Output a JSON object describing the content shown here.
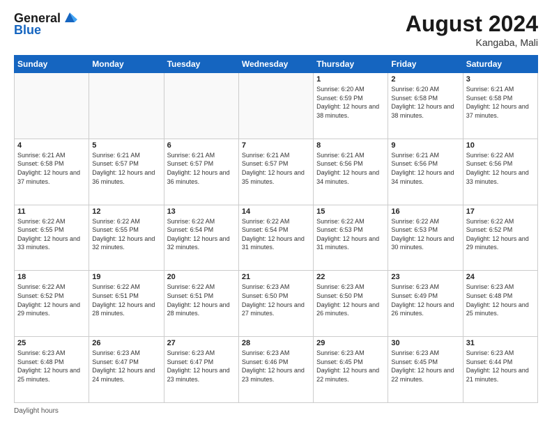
{
  "header": {
    "logo_general": "General",
    "logo_blue": "Blue",
    "month_year": "August 2024",
    "location": "Kangaba, Mali"
  },
  "footer": {
    "daylight_label": "Daylight hours"
  },
  "days_of_week": [
    "Sunday",
    "Monday",
    "Tuesday",
    "Wednesday",
    "Thursday",
    "Friday",
    "Saturday"
  ],
  "weeks": [
    [
      {
        "day": "",
        "info": ""
      },
      {
        "day": "",
        "info": ""
      },
      {
        "day": "",
        "info": ""
      },
      {
        "day": "",
        "info": ""
      },
      {
        "day": "1",
        "info": "Sunrise: 6:20 AM\nSunset: 6:59 PM\nDaylight: 12 hours\nand 38 minutes."
      },
      {
        "day": "2",
        "info": "Sunrise: 6:20 AM\nSunset: 6:58 PM\nDaylight: 12 hours\nand 38 minutes."
      },
      {
        "day": "3",
        "info": "Sunrise: 6:21 AM\nSunset: 6:58 PM\nDaylight: 12 hours\nand 37 minutes."
      }
    ],
    [
      {
        "day": "4",
        "info": "Sunrise: 6:21 AM\nSunset: 6:58 PM\nDaylight: 12 hours\nand 37 minutes."
      },
      {
        "day": "5",
        "info": "Sunrise: 6:21 AM\nSunset: 6:57 PM\nDaylight: 12 hours\nand 36 minutes."
      },
      {
        "day": "6",
        "info": "Sunrise: 6:21 AM\nSunset: 6:57 PM\nDaylight: 12 hours\nand 36 minutes."
      },
      {
        "day": "7",
        "info": "Sunrise: 6:21 AM\nSunset: 6:57 PM\nDaylight: 12 hours\nand 35 minutes."
      },
      {
        "day": "8",
        "info": "Sunrise: 6:21 AM\nSunset: 6:56 PM\nDaylight: 12 hours\nand 34 minutes."
      },
      {
        "day": "9",
        "info": "Sunrise: 6:21 AM\nSunset: 6:56 PM\nDaylight: 12 hours\nand 34 minutes."
      },
      {
        "day": "10",
        "info": "Sunrise: 6:22 AM\nSunset: 6:56 PM\nDaylight: 12 hours\nand 33 minutes."
      }
    ],
    [
      {
        "day": "11",
        "info": "Sunrise: 6:22 AM\nSunset: 6:55 PM\nDaylight: 12 hours\nand 33 minutes."
      },
      {
        "day": "12",
        "info": "Sunrise: 6:22 AM\nSunset: 6:55 PM\nDaylight: 12 hours\nand 32 minutes."
      },
      {
        "day": "13",
        "info": "Sunrise: 6:22 AM\nSunset: 6:54 PM\nDaylight: 12 hours\nand 32 minutes."
      },
      {
        "day": "14",
        "info": "Sunrise: 6:22 AM\nSunset: 6:54 PM\nDaylight: 12 hours\nand 31 minutes."
      },
      {
        "day": "15",
        "info": "Sunrise: 6:22 AM\nSunset: 6:53 PM\nDaylight: 12 hours\nand 31 minutes."
      },
      {
        "day": "16",
        "info": "Sunrise: 6:22 AM\nSunset: 6:53 PM\nDaylight: 12 hours\nand 30 minutes."
      },
      {
        "day": "17",
        "info": "Sunrise: 6:22 AM\nSunset: 6:52 PM\nDaylight: 12 hours\nand 29 minutes."
      }
    ],
    [
      {
        "day": "18",
        "info": "Sunrise: 6:22 AM\nSunset: 6:52 PM\nDaylight: 12 hours\nand 29 minutes."
      },
      {
        "day": "19",
        "info": "Sunrise: 6:22 AM\nSunset: 6:51 PM\nDaylight: 12 hours\nand 28 minutes."
      },
      {
        "day": "20",
        "info": "Sunrise: 6:22 AM\nSunset: 6:51 PM\nDaylight: 12 hours\nand 28 minutes."
      },
      {
        "day": "21",
        "info": "Sunrise: 6:23 AM\nSunset: 6:50 PM\nDaylight: 12 hours\nand 27 minutes."
      },
      {
        "day": "22",
        "info": "Sunrise: 6:23 AM\nSunset: 6:50 PM\nDaylight: 12 hours\nand 26 minutes."
      },
      {
        "day": "23",
        "info": "Sunrise: 6:23 AM\nSunset: 6:49 PM\nDaylight: 12 hours\nand 26 minutes."
      },
      {
        "day": "24",
        "info": "Sunrise: 6:23 AM\nSunset: 6:48 PM\nDaylight: 12 hours\nand 25 minutes."
      }
    ],
    [
      {
        "day": "25",
        "info": "Sunrise: 6:23 AM\nSunset: 6:48 PM\nDaylight: 12 hours\nand 25 minutes."
      },
      {
        "day": "26",
        "info": "Sunrise: 6:23 AM\nSunset: 6:47 PM\nDaylight: 12 hours\nand 24 minutes."
      },
      {
        "day": "27",
        "info": "Sunrise: 6:23 AM\nSunset: 6:47 PM\nDaylight: 12 hours\nand 23 minutes."
      },
      {
        "day": "28",
        "info": "Sunrise: 6:23 AM\nSunset: 6:46 PM\nDaylight: 12 hours\nand 23 minutes."
      },
      {
        "day": "29",
        "info": "Sunrise: 6:23 AM\nSunset: 6:45 PM\nDaylight: 12 hours\nand 22 minutes."
      },
      {
        "day": "30",
        "info": "Sunrise: 6:23 AM\nSunset: 6:45 PM\nDaylight: 12 hours\nand 22 minutes."
      },
      {
        "day": "31",
        "info": "Sunrise: 6:23 AM\nSunset: 6:44 PM\nDaylight: 12 hours\nand 21 minutes."
      }
    ]
  ]
}
